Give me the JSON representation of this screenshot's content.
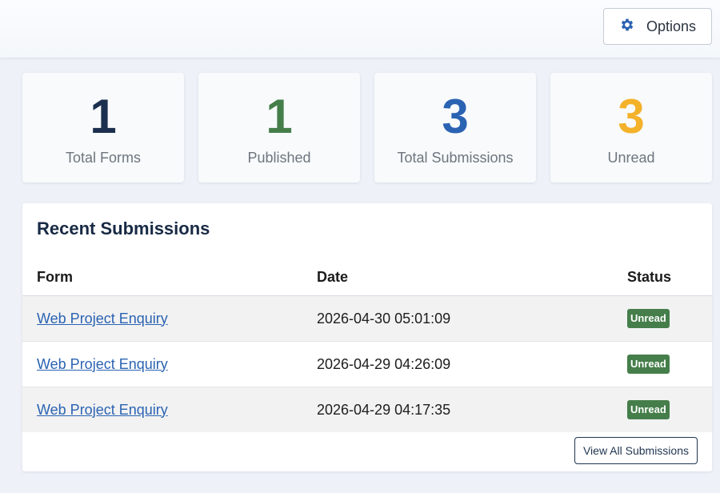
{
  "header": {
    "options_label": "Options",
    "options_icon": "gear-icon"
  },
  "stats": [
    {
      "value": "1",
      "label": "Total Forms",
      "color": "#1c2f4e"
    },
    {
      "value": "1",
      "label": "Published",
      "color": "#457e4a"
    },
    {
      "value": "3",
      "label": "Total Submissions",
      "color": "#2b63b3"
    },
    {
      "value": "3",
      "label": "Unread",
      "color": "#f4b12a"
    }
  ],
  "recent": {
    "title": "Recent Submissions",
    "columns": {
      "form": "Form",
      "date": "Date",
      "status": "Status"
    },
    "rows": [
      {
        "form": "Web Project Enquiry",
        "date": "2026-04-30 05:01:09",
        "status": "Unread"
      },
      {
        "form": "Web Project Enquiry",
        "date": "2026-04-29 04:26:09",
        "status": "Unread"
      },
      {
        "form": "Web Project Enquiry",
        "date": "2026-04-29 04:17:35",
        "status": "Unread"
      }
    ],
    "view_all_label": "View All Submissions"
  },
  "colors": {
    "link": "#2b63b3",
    "badge": "#457e4a",
    "accent": "#2b63b3"
  }
}
